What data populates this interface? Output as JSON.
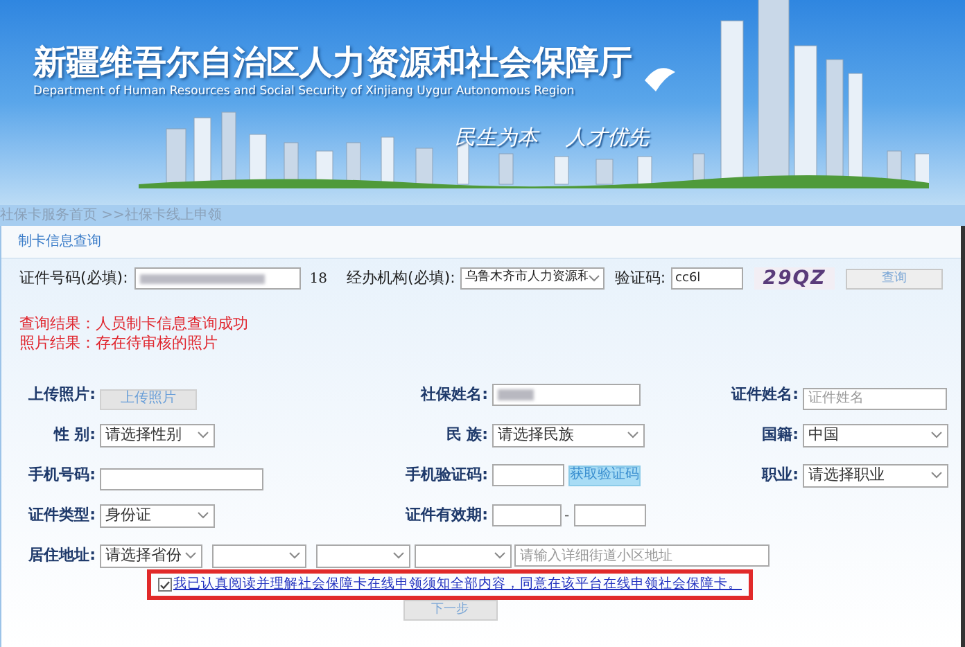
{
  "header": {
    "title": "新疆维吾尔自治区人力资源和社会保障厅",
    "subtitle": "Department of Human Resources and Social Security of Xinjiang Uygur Autonomous Region",
    "slogans": [
      "民生为本",
      "人才优先"
    ]
  },
  "breadcrumb": "社保卡服务首页 >>社保卡线上申领",
  "section_title": "制卡信息查询",
  "query": {
    "id_label": "证件号码(必填):",
    "id_length": "18",
    "agency_label": "经办机构(必填):",
    "agency_value": "乌鲁木齐市人力资源和",
    "captcha_label": "验证码:",
    "captcha_value": "cc6l",
    "captcha_image": "29QZ",
    "button": "查询"
  },
  "results": [
    "查询结果：人员制卡信息查询成功",
    "照片结果：存在待审核的照片"
  ],
  "rows": [
    [
      {
        "label": "上传照片:",
        "kind": "button",
        "text": "上传照片"
      },
      {
        "label": "社保姓名:",
        "kind": "redacted"
      },
      {
        "label": "证件姓名:",
        "kind": "input",
        "placeholder": "证件姓名"
      }
    ],
    [
      {
        "label": "性 别:",
        "kind": "select",
        "value": "请选择性别"
      },
      {
        "label": "民 族:",
        "kind": "select",
        "value": "请选择民族"
      },
      {
        "label": "国籍:",
        "kind": "select",
        "value": "中国"
      }
    ],
    [
      {
        "label": "手机号码:",
        "kind": "input"
      },
      {
        "label": "手机验证码:",
        "kind": "input_button",
        "button": "获取验证码"
      },
      {
        "label": "职业:",
        "kind": "select",
        "value": "请选择职业"
      }
    ],
    [
      {
        "label": "证件类型:",
        "kind": "select",
        "value": "身份证"
      },
      {
        "label": "证件有效期:",
        "kind": "date_range",
        "separator": "-"
      }
    ]
  ],
  "address": {
    "label": "居住地址:",
    "province": "请选择省份",
    "street_placeholder": "请输入详细街道小区地址"
  },
  "agreement": {
    "checked": true,
    "text": "我已认真阅读并理解社会保障卡在线申领须知全部内容，同意在该平台在线申领社会保障卡。"
  },
  "next_button": "下一步"
}
